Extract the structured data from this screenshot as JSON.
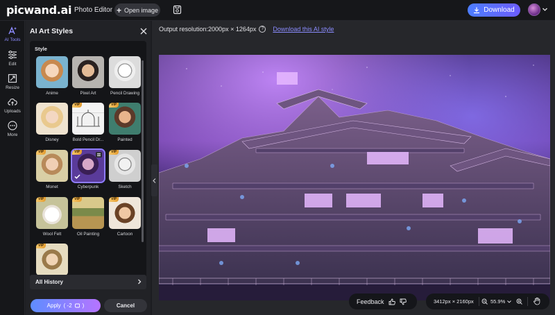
{
  "app": {
    "logo": "picwand.ai",
    "menu_photo_editor": "Photo Editor"
  },
  "toolbar": {
    "open_image": "Open image",
    "download": "Download"
  },
  "rail": [
    {
      "label": "AI Tools",
      "icon": "ai-tools-icon",
      "active": true
    },
    {
      "label": "Edit",
      "icon": "sliders-icon"
    },
    {
      "label": "Resize",
      "icon": "resize-icon"
    },
    {
      "label": "Uploads",
      "icon": "cloud-upload-icon"
    },
    {
      "label": "More",
      "icon": "more-icon"
    }
  ],
  "panel": {
    "title": "AI Art Styles",
    "section": "Style",
    "styles": [
      {
        "name": "Anime",
        "vip": false,
        "selected": false
      },
      {
        "name": "Pixel Art",
        "vip": false,
        "selected": false
      },
      {
        "name": "Pencil Drawing",
        "vip": false,
        "selected": false
      },
      {
        "name": "Disney",
        "vip": false,
        "selected": false
      },
      {
        "name": "Bold Pencil Dr...",
        "vip": true,
        "selected": false
      },
      {
        "name": "Painted",
        "vip": true,
        "selected": false
      },
      {
        "name": "Monet",
        "vip": true,
        "selected": false
      },
      {
        "name": "Cyberpunk",
        "vip": true,
        "selected": true
      },
      {
        "name": "Sketch",
        "vip": true,
        "selected": false
      },
      {
        "name": "Wool Felt",
        "vip": true,
        "selected": false
      },
      {
        "name": "Oil Painting",
        "vip": true,
        "selected": false
      },
      {
        "name": "Cartoon",
        "vip": true,
        "selected": false
      },
      {
        "name": "",
        "vip": true,
        "selected": false
      }
    ],
    "vip_label": "VIP",
    "history": "All History",
    "apply": "Apply",
    "apply_cost": "( -2",
    "apply_cost_end": ")",
    "cancel": "Cancel"
  },
  "canvas": {
    "output_resolution": "Output resolution:2000px × 1264px",
    "download_style": "Download this AI style",
    "help": "?"
  },
  "footer": {
    "feedback": "Feedback",
    "dimensions": "3412px × 2160px",
    "zoom": "55.9%"
  },
  "colors": {
    "accent": "#6c5dff",
    "vip": "#f0b24a",
    "background": "#1c1d21"
  }
}
